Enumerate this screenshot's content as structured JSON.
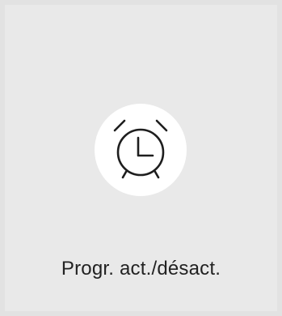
{
  "tile": {
    "label": "Progr. act./désact.",
    "icon": "alarm-clock-icon"
  },
  "colors": {
    "page_background": "#e2e2e2",
    "tile_background": "#e9e9e9",
    "icon_circle": "#ffffff",
    "icon_stroke": "#1e1e1e",
    "label_text": "#222222"
  }
}
